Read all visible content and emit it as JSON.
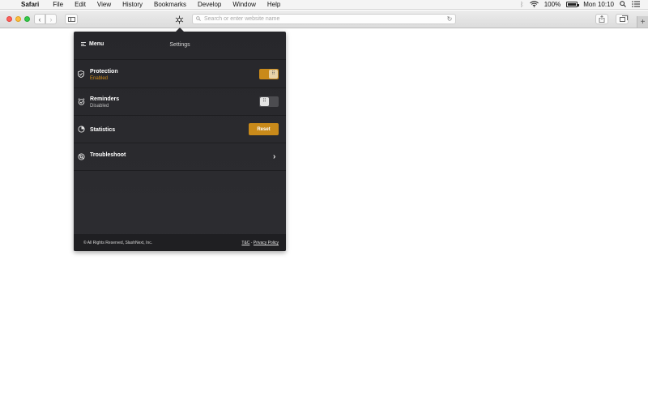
{
  "menubar": {
    "apple": "",
    "app": "Safari",
    "items": [
      "File",
      "Edit",
      "View",
      "History",
      "Bookmarks",
      "Develop",
      "Window",
      "Help"
    ],
    "battery": "100%",
    "clock": "Mon 10:10"
  },
  "toolbar": {
    "address_placeholder": "Search or enter website name"
  },
  "popup": {
    "menu_label": "Menu",
    "title": "Settings",
    "rows": [
      {
        "label": "Protection",
        "status": "Enabled"
      },
      {
        "label": "Reminders",
        "status": "Disabled"
      },
      {
        "label": "Statistics",
        "action": "Reset"
      },
      {
        "label": "Troubleshoot"
      }
    ],
    "footer": {
      "copyright": "© All Rights Reserved, SlashNext, Inc.",
      "tc": "T&C",
      "separator": " - ",
      "privacy": "Privacy Policy"
    }
  },
  "colors": {
    "accent": "#c98a1a",
    "popup_bg": "#2b2b2f"
  }
}
